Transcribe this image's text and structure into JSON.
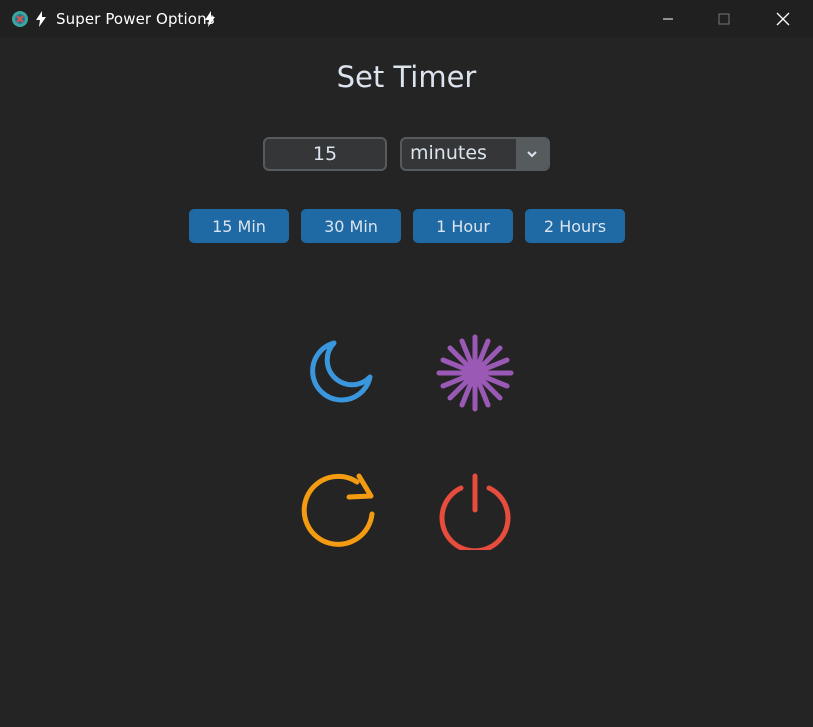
{
  "window": {
    "title": "Super Power Options",
    "minimize_icon": "minimize-icon",
    "maximize_icon": "maximize-icon",
    "close_icon": "close-icon"
  },
  "main": {
    "heading": "Set Timer",
    "duration_value": "15",
    "unit_selected": "minutes",
    "presets": [
      {
        "label": "15 Min"
      },
      {
        "label": "30 Min"
      },
      {
        "label": "1 Hour"
      },
      {
        "label": "2 Hours"
      }
    ],
    "actions": [
      {
        "icon": "moon-icon",
        "color": "#3a96dd"
      },
      {
        "icon": "snowflake-icon",
        "color": "#9b59b6"
      },
      {
        "icon": "restart-icon",
        "color": "#f39c12"
      },
      {
        "icon": "power-icon",
        "color": "#e74c3c"
      }
    ]
  },
  "colors": {
    "background": "#242424",
    "titlebar": "#202020",
    "accent": "#1f6aa5",
    "input_bg": "#343638",
    "border": "#565b5e"
  }
}
